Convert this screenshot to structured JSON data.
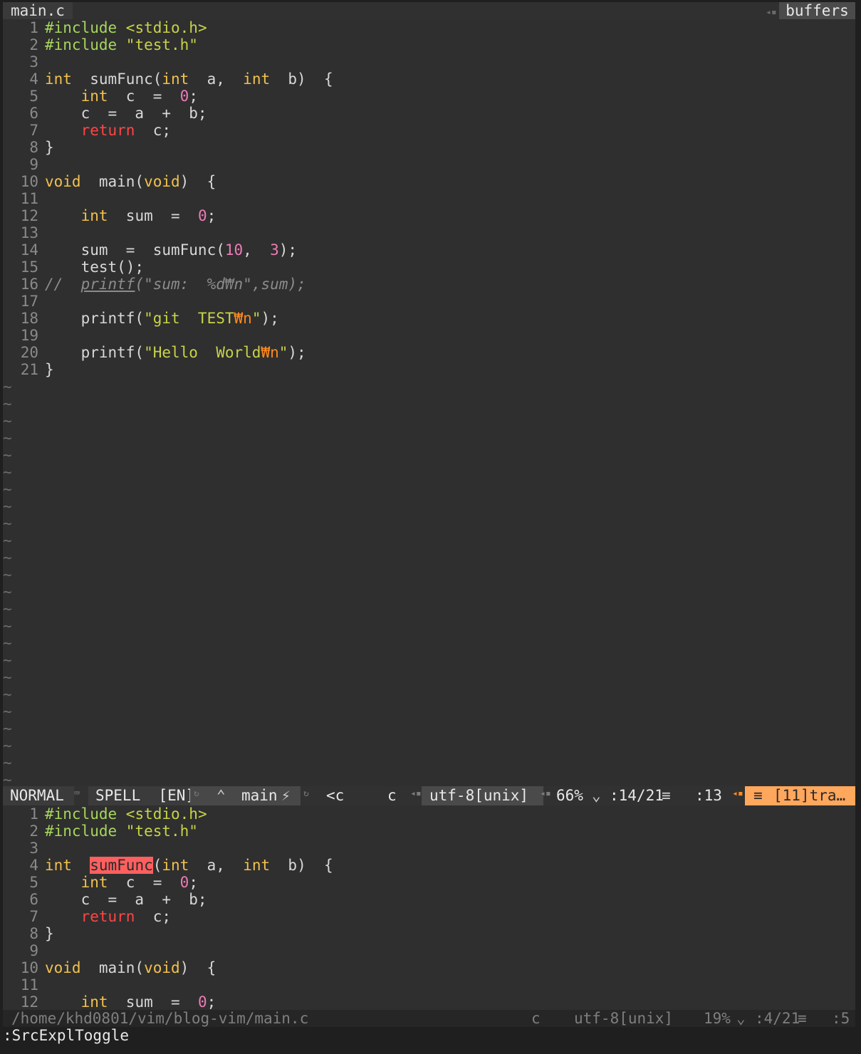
{
  "tabline": {
    "active_tab": "main.c",
    "buffers_label": "buffers"
  },
  "editor_top": {
    "lines": [
      {
        "n": "1",
        "tokens": [
          [
            "pp",
            "#include "
          ],
          [
            "str",
            "<stdio.h>"
          ]
        ]
      },
      {
        "n": "2",
        "tokens": [
          [
            "pp",
            "#include "
          ],
          [
            "str",
            "\"test.h\""
          ]
        ]
      },
      {
        "n": "3",
        "tokens": []
      },
      {
        "n": "4",
        "tokens": [
          [
            "kw",
            "int"
          ],
          [
            "",
            "  sumFunc("
          ],
          [
            "kw",
            "int"
          ],
          [
            "",
            "  a,  "
          ],
          [
            "kw",
            "int"
          ],
          [
            "",
            "  b)  {"
          ]
        ]
      },
      {
        "n": "5",
        "tokens": [
          [
            "",
            "    "
          ],
          [
            "kw",
            "int"
          ],
          [
            "",
            "  c  =  "
          ],
          [
            "num",
            "0"
          ],
          [
            "",
            ";"
          ]
        ]
      },
      {
        "n": "6",
        "tokens": [
          [
            "",
            "    c  =  a  +  b;"
          ]
        ]
      },
      {
        "n": "7",
        "tokens": [
          [
            "",
            "    "
          ],
          [
            "ret",
            "return"
          ],
          [
            "",
            "  c;"
          ]
        ]
      },
      {
        "n": "8",
        "tokens": [
          [
            "",
            "}"
          ]
        ]
      },
      {
        "n": "9",
        "tokens": []
      },
      {
        "n": "10",
        "tokens": [
          [
            "kw",
            "void"
          ],
          [
            "",
            "  main("
          ],
          [
            "kw",
            "void"
          ],
          [
            "",
            ")  {"
          ]
        ]
      },
      {
        "n": "11",
        "tokens": []
      },
      {
        "n": "12",
        "tokens": [
          [
            "",
            "    "
          ],
          [
            "kw",
            "int"
          ],
          [
            "",
            "  sum  =  "
          ],
          [
            "num",
            "0"
          ],
          [
            "",
            ";"
          ]
        ]
      },
      {
        "n": "13",
        "tokens": []
      },
      {
        "n": "14",
        "tokens": [
          [
            "",
            "    sum  =  sumFunc("
          ],
          [
            "num",
            "10"
          ],
          [
            "",
            ",  "
          ],
          [
            "num",
            "3"
          ],
          [
            "",
            ");"
          ]
        ]
      },
      {
        "n": "15",
        "tokens": [
          [
            "",
            "    test();"
          ]
        ]
      },
      {
        "n": "16",
        "tokens": [
          [
            "cmt",
            "//  "
          ],
          [
            "cmt-u",
            "printf"
          ],
          [
            "cmt",
            "(\"sum:  %d₩n\",sum);"
          ]
        ]
      },
      {
        "n": "17",
        "tokens": []
      },
      {
        "n": "18",
        "tokens": [
          [
            "",
            "    printf("
          ],
          [
            "str",
            "\"git  TEST"
          ],
          [
            "esc",
            "₩n"
          ],
          [
            "str",
            "\""
          ],
          [
            "",
            ");"
          ]
        ]
      },
      {
        "n": "19",
        "tokens": []
      },
      {
        "n": "20",
        "tokens": [
          [
            "",
            "    printf("
          ],
          [
            "str",
            "\"Hello  World"
          ],
          [
            "esc",
            "₩n"
          ],
          [
            "str",
            "\""
          ],
          [
            "",
            ");"
          ]
        ]
      },
      {
        "n": "21",
        "tokens": [
          [
            "",
            "}"
          ]
        ]
      }
    ],
    "tilde": "~"
  },
  "statusline": {
    "mode": "NORMAL",
    "spell": "SPELL  [EN]",
    "branch": "main",
    "tag": "<c",
    "filetype": "c",
    "encoding": "utf-8[unix]",
    "percent": "66%",
    "line_pos": ":14/21",
    "col": ":13",
    "warning": "[11]tra…"
  },
  "editor_bottom": {
    "lines": [
      {
        "n": "1",
        "tokens": [
          [
            "pp",
            "#include "
          ],
          [
            "str",
            "<stdio.h>"
          ]
        ]
      },
      {
        "n": "2",
        "tokens": [
          [
            "pp",
            "#include "
          ],
          [
            "str",
            "\"test.h\""
          ]
        ]
      },
      {
        "n": "3",
        "tokens": []
      },
      {
        "n": "4",
        "tokens": [
          [
            "kw",
            "int"
          ],
          [
            "",
            "  "
          ],
          [
            "hl",
            "sumFunc"
          ],
          [
            "",
            "("
          ],
          [
            "kw",
            "int"
          ],
          [
            "",
            "  a,  "
          ],
          [
            "kw",
            "int"
          ],
          [
            "",
            "  b)  {"
          ]
        ]
      },
      {
        "n": "5",
        "tokens": [
          [
            "",
            "    "
          ],
          [
            "kw",
            "int"
          ],
          [
            "",
            "  c  =  "
          ],
          [
            "num",
            "0"
          ],
          [
            "",
            ";"
          ]
        ]
      },
      {
        "n": "6",
        "tokens": [
          [
            "",
            "    c  =  a  +  b;"
          ]
        ]
      },
      {
        "n": "7",
        "tokens": [
          [
            "",
            "    "
          ],
          [
            "ret",
            "return"
          ],
          [
            "",
            "  c;"
          ]
        ]
      },
      {
        "n": "8",
        "tokens": [
          [
            "",
            "}"
          ]
        ]
      },
      {
        "n": "9",
        "tokens": []
      },
      {
        "n": "10",
        "tokens": [
          [
            "kw",
            "void"
          ],
          [
            "",
            "  main("
          ],
          [
            "kw",
            "void"
          ],
          [
            "",
            ")  {"
          ]
        ]
      },
      {
        "n": "11",
        "tokens": []
      },
      {
        "n": "12",
        "tokens": [
          [
            "",
            "    "
          ],
          [
            "kw",
            "int"
          ],
          [
            "",
            "  sum  =  "
          ],
          [
            "num",
            "0"
          ],
          [
            "",
            ";"
          ]
        ]
      }
    ]
  },
  "statusline_bottom": {
    "path": "/home/khd0801/vim/blog-vim/main.c",
    "filetype": "c",
    "encoding": "utf-8[unix]",
    "percent": "19%",
    "line_pos": ":4/21",
    "col": ":5"
  },
  "cmdline": {
    "text": ":SrcExplToggle"
  },
  "colors": {
    "keyword": "#f2c14e",
    "return": "#ff4545",
    "number": "#ec7cb5",
    "string": "#c8d347",
    "preproc": "#a6d65c",
    "escape": "#ff8a1d",
    "warning_bg": "#ffa75c",
    "search_highlight": "#ff5f5f"
  }
}
